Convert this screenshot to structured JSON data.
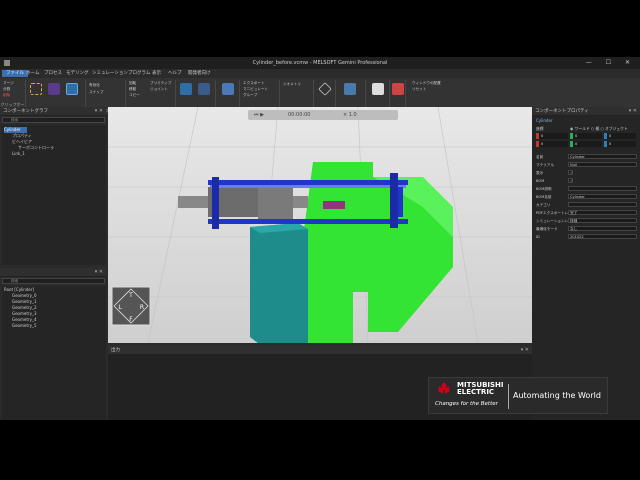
{
  "window": {
    "title": "Cylinder_before.vcmw - MELSOFT Gemini Professional",
    "controls": "— ☐ ✕"
  },
  "menu": {
    "items": [
      "ファイル",
      "ホーム",
      "プロセス",
      "モデリング",
      "シミュレーション",
      "プログラム",
      "表示",
      "ヘルプ",
      "開発者向け"
    ],
    "active_index": 0
  },
  "ribbon": {
    "groups": [
      {
        "label": "クリップボード"
      },
      {
        "label": "マニピュレーション"
      },
      {
        "label": "グリッドスナップ"
      },
      {
        "label": "ツール"
      },
      {
        "label": "移動モード"
      },
      {
        "label": "インポート"
      },
      {
        "label": "エクスポート"
      },
      {
        "label": "構造"
      },
      {
        "label": "ジオメトリ"
      },
      {
        "label": "自作の図形"
      },
      {
        "label": "プロパティ"
      },
      {
        "label": "表示"
      },
      {
        "label": "ウィンドウ"
      }
    ],
    "small_items": [
      "マージ",
      "分割",
      "削除",
      "回転",
      "移動",
      "コピー",
      "貼り付け",
      "有効化",
      "スナップ",
      "プリミティブ",
      "ジョイント",
      "インポート",
      "エクスポート",
      "マニピュレート",
      "グループ",
      "ジオメトリ",
      "最適化",
      "ウィンドウの配置",
      "リセット"
    ]
  },
  "component_graph": {
    "title": "コンポーネントグラフ",
    "search_placeholder": "検索",
    "items": [
      {
        "label": "Cylinder",
        "selected": true
      },
      {
        "label": "プロパティ"
      },
      {
        "label": "ビヘイビア"
      },
      {
        "label": "サーボコントローラ"
      },
      {
        "label": "Link_1"
      }
    ]
  },
  "geometry_tree": {
    "search_placeholder": "検索",
    "items": [
      "Root [Cylinder]",
      "Geometry_0",
      "Geometry_1",
      "Geometry_2",
      "Geometry_3",
      "Geometry_4",
      "Geometry_5"
    ]
  },
  "playback": {
    "time": "00:00:00",
    "speed": "× 1.0"
  },
  "output": {
    "title": "出力"
  },
  "props": {
    "title": "コンポーネントプロパティ",
    "subtitle": "Cylinder",
    "coord_label": "座標",
    "coord_options": [
      "ワールド",
      "親",
      "オブジェクト"
    ],
    "xyz": [
      {
        "axis": "X",
        "value": "0",
        "color": "#c0392b"
      },
      {
        "axis": "Y",
        "value": "0",
        "color": "#27ae60"
      },
      {
        "axis": "Z",
        "value": "0",
        "color": "#2980b9"
      },
      {
        "axis": "Rx",
        "value": "0",
        "color": "#c0392b"
      },
      {
        "axis": "Ry",
        "value": "0",
        "color": "#27ae60"
      },
      {
        "axis": "Rz",
        "value": "0",
        "color": "#2980b9"
      }
    ],
    "rows": [
      {
        "key": "名前",
        "value": "Cylinder"
      },
      {
        "key": "マテリアル",
        "value": "Null"
      },
      {
        "key": "表示",
        "value": "✓"
      },
      {
        "key": "BOM",
        "value": "✓"
      },
      {
        "key": "BOM説明",
        "value": ""
      },
      {
        "key": "BOM名前",
        "value": "Cylinder"
      },
      {
        "key": "カテゴリ",
        "value": ""
      },
      {
        "key": "PDFエクスポートレベル",
        "value": "完了"
      },
      {
        "key": "シミュレーションレベル",
        "value": "詳細"
      },
      {
        "key": "最適化モード",
        "value": "なし"
      },
      {
        "key": "ID",
        "value": "201022"
      }
    ]
  },
  "brand": {
    "name_top": "MITSUBISHI",
    "name_bottom": "ELECTRIC",
    "tagline": "Changes for the Better",
    "slogan": "Automating the World"
  },
  "colors": {
    "accent": "#3a6fb0",
    "green": "#33e433",
    "teal": "#1f8c8c",
    "blue": "#2036c8",
    "logo_red": "#d0021b"
  },
  "nav_cube": {
    "top": "T",
    "left": "L",
    "right": "R",
    "front": "F"
  }
}
